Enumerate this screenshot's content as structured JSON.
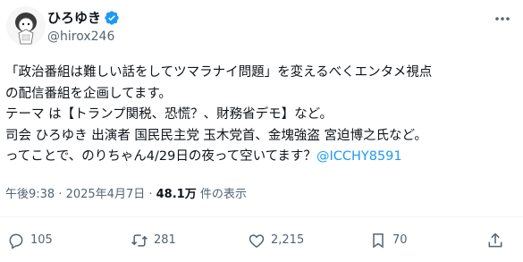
{
  "author": {
    "display_name": "ひろゆき",
    "handle": "@hirox246",
    "verified": true,
    "verified_color": "#1d9bf0"
  },
  "tweet": {
    "lines": [
      "「政治番組は難しい話をしてツマラナイ問題」を変えるべくエンタメ視点",
      "の配信番組を企画してます。",
      "テーマ は【トランプ関税、恐慌？、財務省デモ】など。",
      "司会 ひろゆき 出演者 国民民主党 玉木党首、金塊強盗 宮迫博之氏など。"
    ],
    "last_line_text": "ってことで、のりちゃん4/29日の夜って空いてます？",
    "mention": "@ICCHY8591",
    "mention_color": "#1d9bf0"
  },
  "meta": {
    "timestamp": "午後9:38 · 2025年4月7日 · ",
    "views_count": "48.1万",
    "views_label": " 件の表示"
  },
  "actions": {
    "reply_count": "105",
    "repost_count": "281",
    "like_count": "2,215",
    "bookmark_count": "70"
  },
  "icons": [
    "verified-badge-icon",
    "more-icon",
    "reply-icon",
    "repost-icon",
    "like-icon",
    "bookmark-icon",
    "share-icon"
  ]
}
